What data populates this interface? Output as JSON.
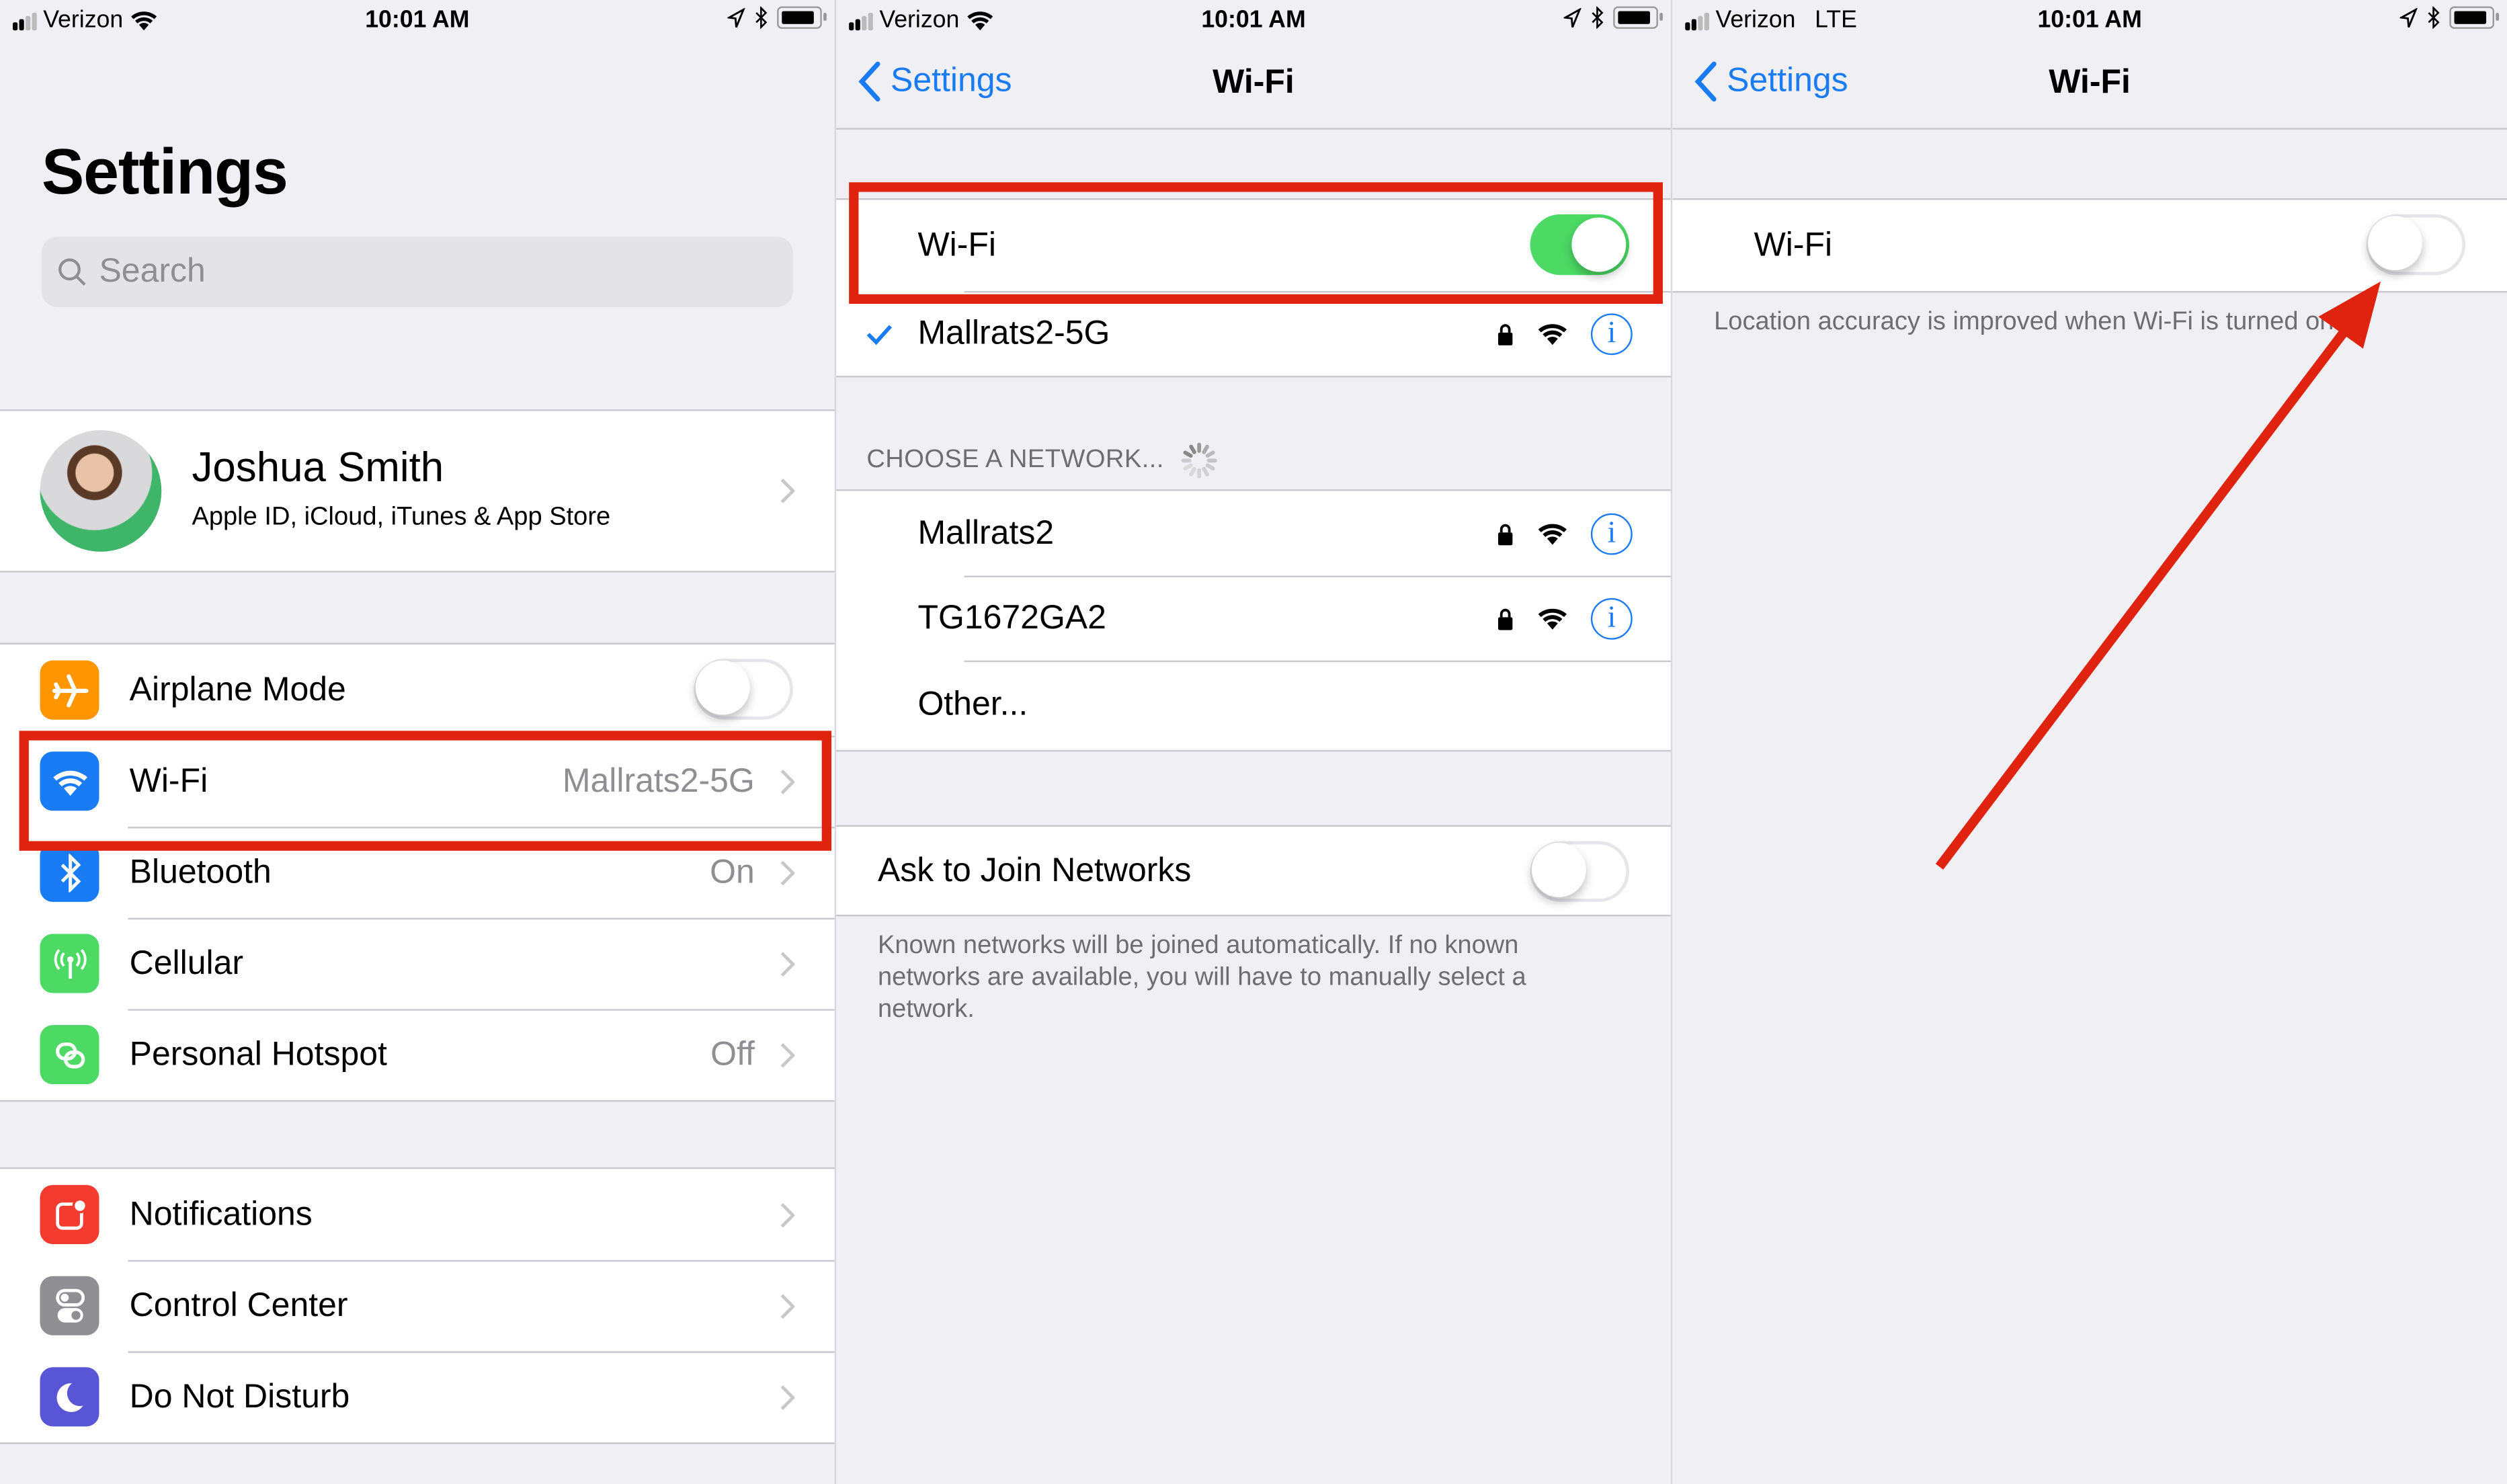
{
  "status_bar": [
    {
      "carrier": "Verizon",
      "network": "wifi",
      "time": "10:01 AM"
    },
    {
      "carrier": "Verizon",
      "network": "wifi",
      "time": "10:01 AM"
    },
    {
      "carrier": "Verizon",
      "network_label": "LTE",
      "time": "10:01 AM"
    }
  ],
  "panel1": {
    "title": "Settings",
    "search_placeholder": "Search",
    "profile": {
      "name": "Joshua Smith",
      "subtitle": "Apple ID, iCloud, iTunes & App Store"
    },
    "group1": [
      {
        "label": "Airplane Mode",
        "icon": "airplane-icon",
        "color": "#ff9500",
        "toggle": false
      },
      {
        "label": "Wi-Fi",
        "icon": "wifi-icon",
        "color": "#1a7cf5",
        "value": "Mallrats2-5G"
      },
      {
        "label": "Bluetooth",
        "icon": "bluetooth-icon",
        "color": "#1a7cf5",
        "value": "On"
      },
      {
        "label": "Cellular",
        "icon": "antenna-icon",
        "color": "#4cd964",
        "value": ""
      },
      {
        "label": "Personal Hotspot",
        "icon": "hotspot-icon",
        "color": "#4cd964",
        "value": "Off"
      }
    ],
    "group2": [
      {
        "label": "Notifications",
        "icon": "notifications-icon",
        "color": "#f33b30"
      },
      {
        "label": "Control Center",
        "icon": "control-center-icon",
        "color": "#8e8e93"
      },
      {
        "label": "Do Not Disturb",
        "icon": "moon-icon",
        "color": "#5856d6"
      }
    ]
  },
  "panel2": {
    "back_label": "Settings",
    "title": "Wi-Fi",
    "wifi_label": "Wi-Fi",
    "wifi_on": true,
    "connected_network": "Mallrats2-5G",
    "choose_header": "CHOOSE A NETWORK...",
    "networks": [
      {
        "name": "Mallrats2",
        "secured": true
      },
      {
        "name": "TG1672GA2",
        "secured": true
      }
    ],
    "other_label": "Other...",
    "ask_join_label": "Ask to Join Networks",
    "ask_join_on": false,
    "ask_join_footnote": "Known networks will be joined automatically. If no known networks are available, you will have to manually select a network.",
    "info_glyph": "i"
  },
  "panel3": {
    "back_label": "Settings",
    "title": "Wi-Fi",
    "wifi_label": "Wi-Fi",
    "wifi_on": false,
    "footnote": "Location accuracy is improved when Wi-Fi is turned on."
  },
  "annotation_color": "#e0230f"
}
